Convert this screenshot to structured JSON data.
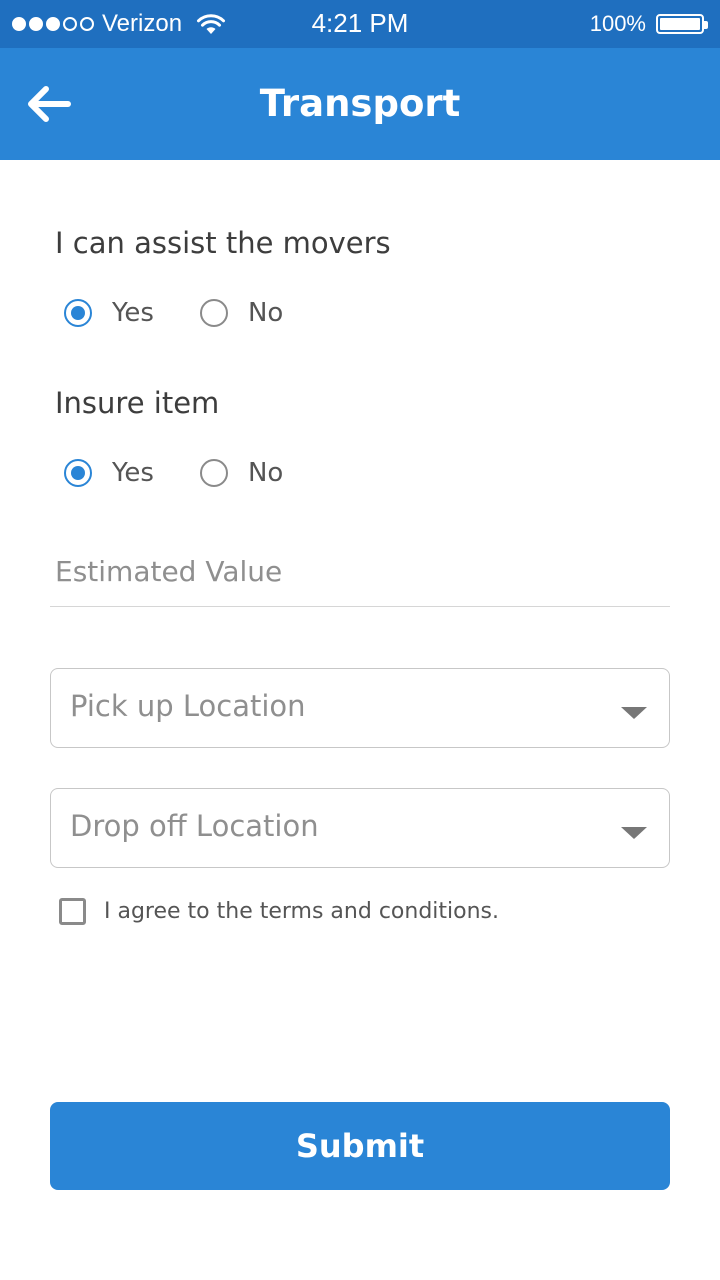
{
  "status_bar": {
    "signal_dots": [
      true,
      true,
      true,
      false,
      false
    ],
    "carrier": "Verizon",
    "wifi_icon": "wifi-icon",
    "time": "4:21 PM",
    "battery_percent": "100%",
    "battery_level": 1.0
  },
  "app_bar": {
    "back_icon": "arrow-left-icon",
    "title": "Transport",
    "color": "#2a85d6"
  },
  "form": {
    "assist_movers": {
      "label": "I can assist the movers",
      "options": [
        "Yes",
        "No"
      ],
      "selected": "Yes"
    },
    "insure_item": {
      "label": "Insure item",
      "options": [
        "Yes",
        "No"
      ],
      "selected": "Yes"
    },
    "estimated_value": {
      "value": "",
      "placeholder": "Estimated Value"
    },
    "pickup_location": {
      "placeholder": "Pick up Location",
      "icon": "chevron-down-icon"
    },
    "dropoff_location": {
      "placeholder": "Drop off Location",
      "icon": "chevron-down-icon"
    },
    "terms": {
      "label": "I agree to the terms and conditions.",
      "checked": false
    },
    "submit_label": "Submit"
  },
  "colors": {
    "status_bar": "#1f6fbf",
    "accent": "#2a85d6"
  }
}
